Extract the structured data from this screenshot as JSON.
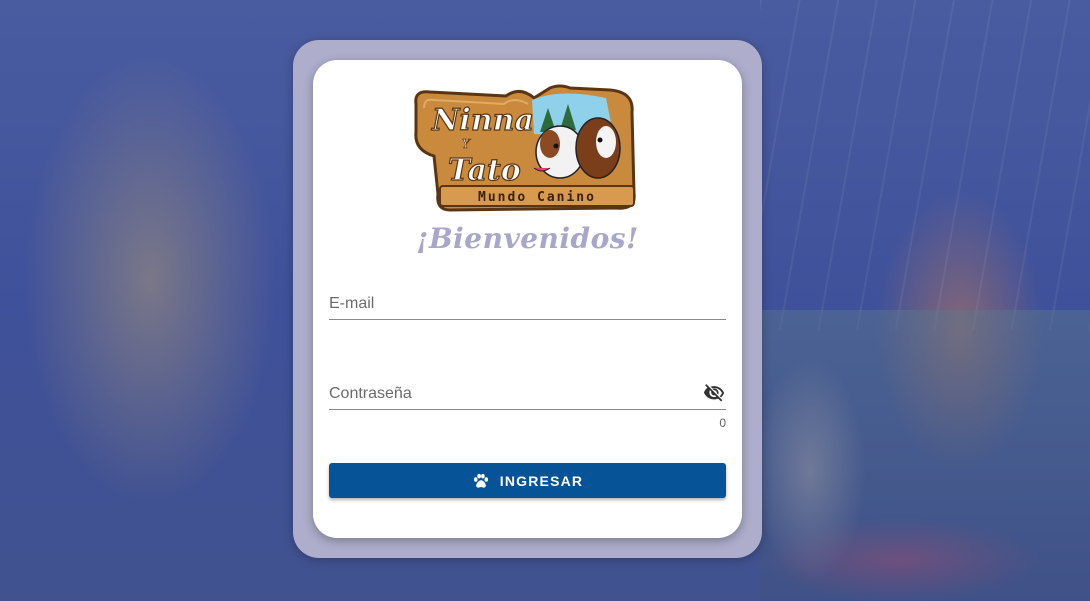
{
  "login": {
    "welcome": "¡Bienvenidos!",
    "email_placeholder": "E-mail",
    "password_placeholder": "Contraseña",
    "password_counter": "0",
    "submit_label": "INGRESAR"
  },
  "logo": {
    "line1": "Ninna",
    "line2": "Y",
    "line3": "Tato",
    "subtitle": "Mundo Canino"
  },
  "icons": {
    "password_toggle": "eye-off-icon",
    "submit": "paw-icon"
  },
  "colors": {
    "primary": "#075398",
    "frame": "#aeaecc",
    "welcome_text": "#a9a6cc",
    "background_overlay": "#4a5ca0"
  }
}
